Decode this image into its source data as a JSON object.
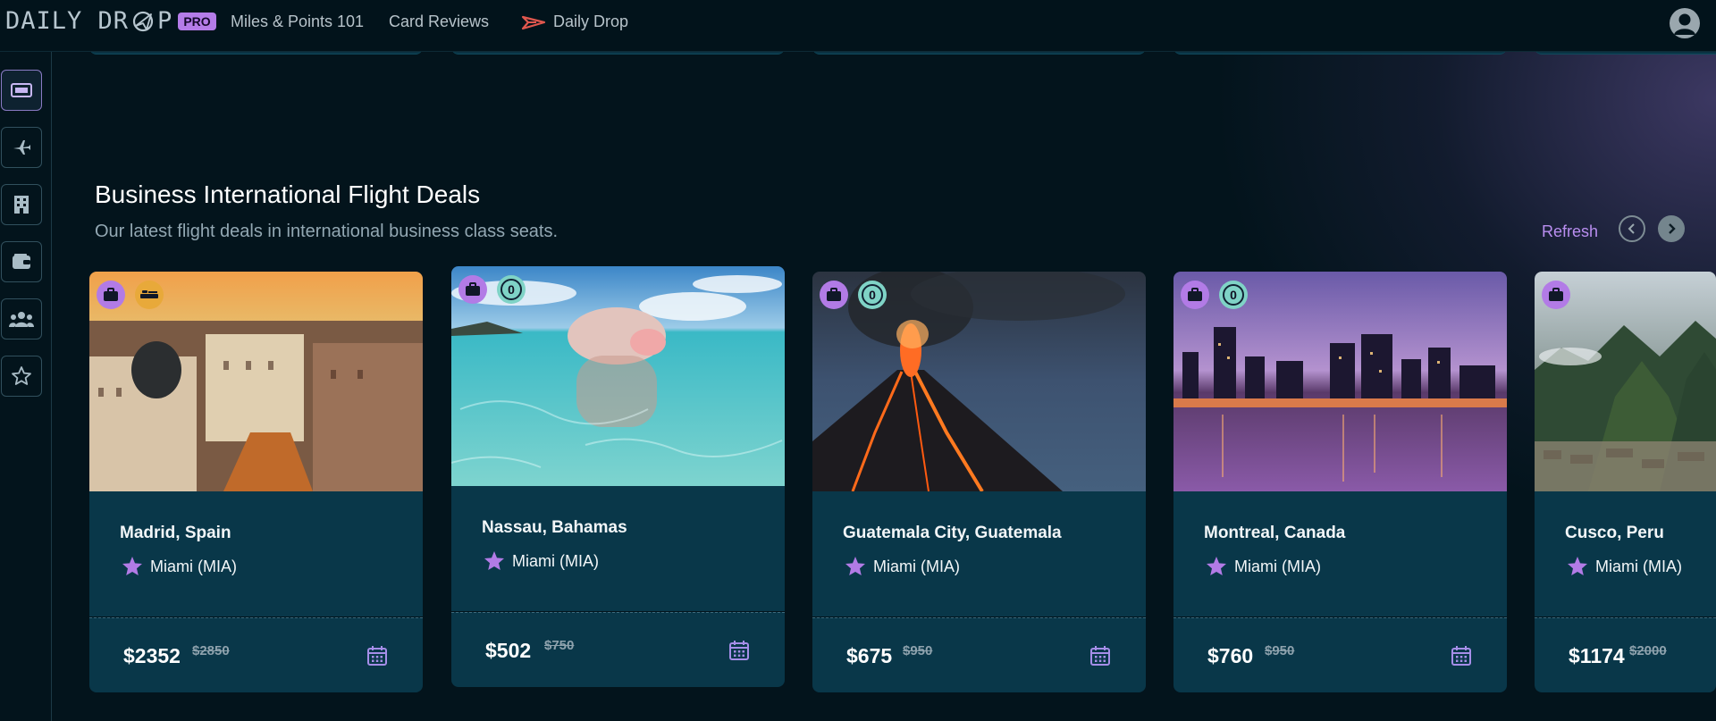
{
  "header": {
    "logo_left": "DAILY DR",
    "logo_right": "P",
    "pro_badge": "PRO",
    "nav": [
      "Miles & Points 101",
      "Card Reviews",
      "Daily Drop"
    ]
  },
  "sidebar": {
    "items": [
      "ticket-icon",
      "plane-icon",
      "hotel-icon",
      "wallet-icon",
      "community-icon",
      "star-icon"
    ]
  },
  "section": {
    "title": "Business International Flight Deals",
    "subtitle": "Our latest flight deals in international business class seats.",
    "refresh_label": "Refresh"
  },
  "deals": [
    {
      "city": "Madrid, Spain",
      "origin": "Miami (MIA)",
      "price": "$2352",
      "old_price": "$2850",
      "badges": [
        "bag",
        "seat"
      ]
    },
    {
      "city": "Nassau, Bahamas",
      "origin": "Miami (MIA)",
      "price": "$502",
      "old_price": "$750",
      "badges": [
        "bag",
        "zero"
      ],
      "zero_text": "0"
    },
    {
      "city": "Guatemala City, Guatemala",
      "origin": "Miami (MIA)",
      "price": "$675",
      "old_price": "$950",
      "badges": [
        "bag",
        "zero"
      ],
      "zero_text": "0"
    },
    {
      "city": "Montreal, Canada",
      "origin": "Miami (MIA)",
      "price": "$760",
      "old_price": "$950",
      "badges": [
        "bag",
        "zero"
      ],
      "zero_text": "0"
    },
    {
      "city": "Cusco, Peru",
      "origin": "Miami (MIA)",
      "price": "$1174",
      "old_price": "$2000",
      "badges": [
        "bag"
      ]
    }
  ],
  "colors": {
    "accent": "#b57ce8",
    "card_bg": "#093749",
    "page_bg": "#03141c"
  }
}
